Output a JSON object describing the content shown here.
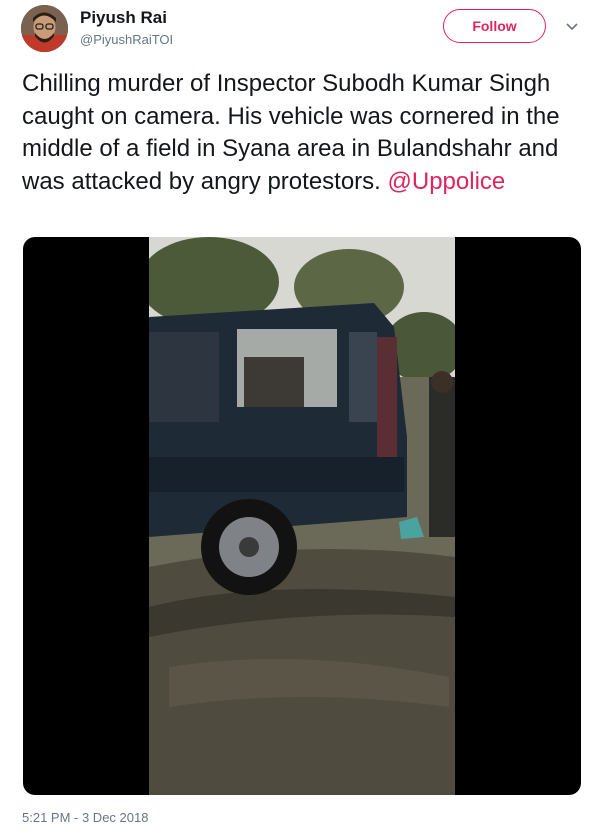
{
  "user": {
    "name": "Piyush Rai",
    "handle": "@PiyushRaiTOI",
    "avatar_icon": "avatar-photo"
  },
  "header": {
    "follow_label": "Follow",
    "caret_icon": "chevron-down-icon"
  },
  "tweet": {
    "text": "Chilling murder of Inspector Subodh Kumar Singh caught on camera. His vehicle was cornered in the middle of a field in Syana area in Bulandshahr and was attacked by angry protestors. ",
    "mention": "@Uppolice",
    "timestamp": "5:21 PM - 3 Dec 2018"
  },
  "media": {
    "type": "video"
  },
  "colors": {
    "accent": "#e0245e",
    "secondary_text": "#657786",
    "primary_text": "#14171a"
  }
}
